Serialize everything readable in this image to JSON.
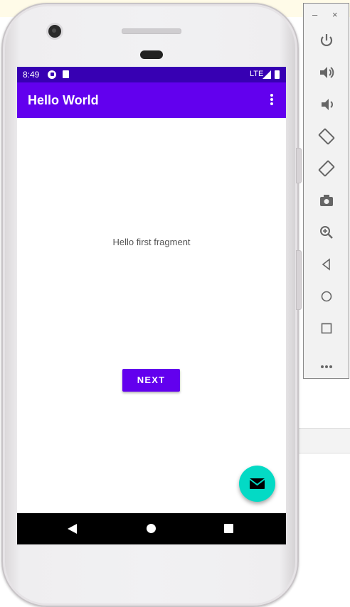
{
  "status_bar": {
    "time": "8:49",
    "network": "LTE"
  },
  "app_bar": {
    "title": "Hello World"
  },
  "content": {
    "message": "Hello first fragment",
    "next_label": "NEXT"
  },
  "fab": {
    "icon": "email-icon",
    "color": "#03dac5"
  },
  "nav_bar": {
    "icons": [
      "back-icon",
      "home-icon",
      "recent-apps-icon"
    ]
  },
  "emulator_toolbar": {
    "minimize_label": "–",
    "close_label": "×",
    "buttons": [
      "power-icon",
      "volume-up-icon",
      "volume-down-icon",
      "rotate-left-icon",
      "rotate-right-icon",
      "camera-icon",
      "zoom-icon",
      "back-icon",
      "home-icon",
      "overview-icon",
      "more-icon"
    ]
  },
  "colors": {
    "primary": "#6200ee",
    "primary_dark": "#3700b3",
    "secondary": "#03dac5"
  }
}
